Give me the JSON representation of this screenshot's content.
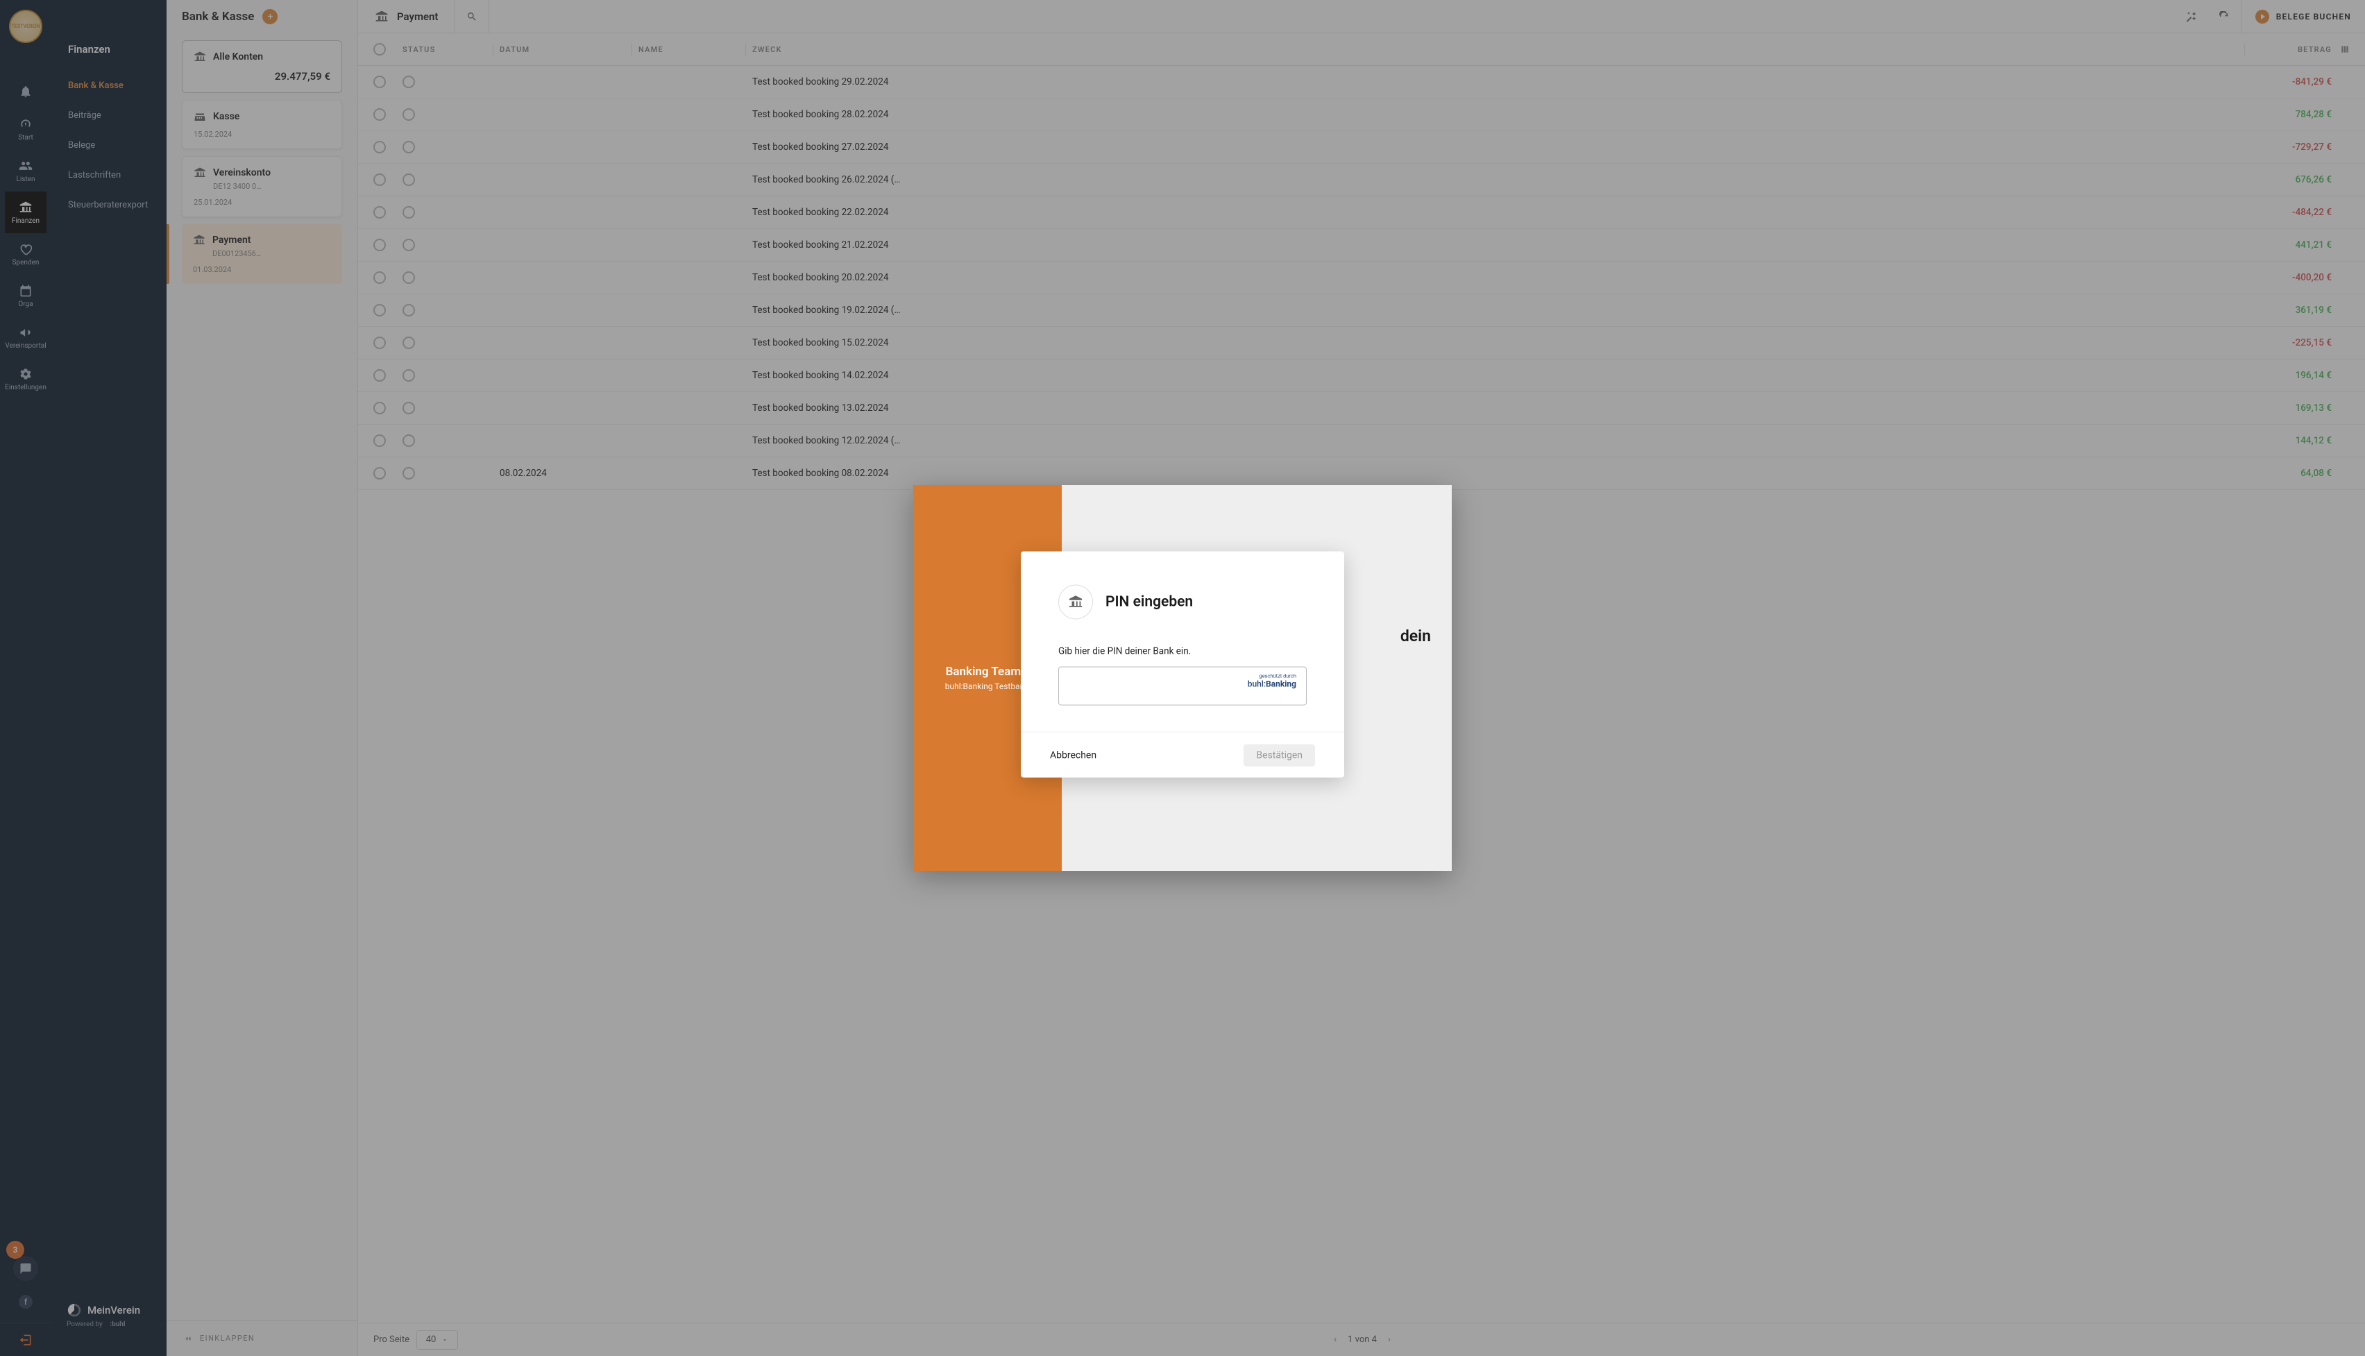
{
  "rail": {
    "logo_text": "TESTVEREIN",
    "items": [
      {
        "label": "Start",
        "icon": "gauge"
      },
      {
        "label": "Listen",
        "icon": "users"
      },
      {
        "label": "Finanzen",
        "icon": "bank",
        "active": true
      },
      {
        "label": "Spenden",
        "icon": "heart"
      },
      {
        "label": "Orga",
        "icon": "calendar"
      },
      {
        "label": "Vereinsportal",
        "icon": "megaphone"
      },
      {
        "label": "Einstellungen",
        "icon": "gear"
      }
    ],
    "notif_icon": "bell",
    "badge_count": "3",
    "chat_icon": "chat",
    "fb_icon": "f",
    "exit_icon": "exit"
  },
  "sidemenu": {
    "title": "Finanzen",
    "items": [
      "Bank & Kasse",
      "Beiträge",
      "Belege",
      "Lastschriften",
      "Steuerberaterexport"
    ],
    "active_index": 0,
    "brand": "MeinVerein",
    "powered": "Powered by",
    "powered_brand": ":buhl"
  },
  "accounts": {
    "title": "Bank & Kasse",
    "list": [
      {
        "name": "Alle Konten",
        "balance": "29.477,59 €",
        "icon": "bank"
      },
      {
        "name": "Kasse",
        "date": "15.02.2024",
        "balance": "",
        "icon": "cash"
      },
      {
        "name": "Vereinskonto",
        "iban": "DE12 3400 0…",
        "date": "25.01.2024",
        "balance": "",
        "icon": "bank"
      },
      {
        "name": "Payment",
        "iban": "DE00123456…",
        "date": "01.03.2024",
        "balance": "",
        "icon": "bank",
        "selected": true
      }
    ],
    "collapse_label": "EINKLAPPEN"
  },
  "main": {
    "title": "Payment",
    "action_label": "BELEGE BUCHEN",
    "columns": {
      "status": "STATUS",
      "datum": "DATUM",
      "name": "NAME",
      "zweck": "ZWECK",
      "betrag": "BETRAG"
    },
    "rows": [
      {
        "zweck": "Test booked booking 29.02.2024",
        "betrag": "-841,29 €",
        "neg": true
      },
      {
        "zweck": "Test booked booking 28.02.2024",
        "betrag": "784,28 €",
        "neg": false
      },
      {
        "zweck": "Test booked booking 27.02.2024",
        "betrag": "-729,27 €",
        "neg": true
      },
      {
        "zweck": "Test booked booking 26.02.2024 (…",
        "betrag": "676,26 €",
        "neg": false
      },
      {
        "zweck": "Test booked booking 22.02.2024",
        "betrag": "-484,22 €",
        "neg": true
      },
      {
        "zweck": "Test booked booking 21.02.2024",
        "betrag": "441,21 €",
        "neg": false
      },
      {
        "zweck": "Test booked booking 20.02.2024",
        "betrag": "-400,20 €",
        "neg": true
      },
      {
        "zweck": "Test booked booking 19.02.2024 (…",
        "betrag": "361,19 €",
        "neg": false
      },
      {
        "zweck": "Test booked booking 15.02.2024",
        "betrag": "-225,15 €",
        "neg": true
      },
      {
        "zweck": "Test booked booking 14.02.2024",
        "betrag": "196,14 €",
        "neg": false
      },
      {
        "zweck": "Test booked booking 13.02.2024",
        "betrag": "169,13 €",
        "neg": false
      },
      {
        "zweck": "Test booked booking 12.02.2024 (…",
        "betrag": "144,12 €",
        "neg": false
      },
      {
        "datum": "08.02.2024",
        "zweck": "Test booked booking 08.02.2024",
        "betrag": "64,08 €",
        "neg": false
      }
    ],
    "footer": {
      "per_page_label": "Pro Seite",
      "per_page_value": "40",
      "page_info": "1 von 4"
    }
  },
  "banking_popup": {
    "left_title": "Banking Team…",
    "left_sub": "buhl:Banking Testban…",
    "right_peek": "dein"
  },
  "pin_modal": {
    "title": "PIN eingeben",
    "desc": "Gib hier die PIN deiner Bank ein.",
    "brand_small": "geschützt durch",
    "brand_main_pre": "buhl:",
    "brand_main_bold": "Banking",
    "cancel": "Abbrechen",
    "confirm": "Bestätigen"
  }
}
